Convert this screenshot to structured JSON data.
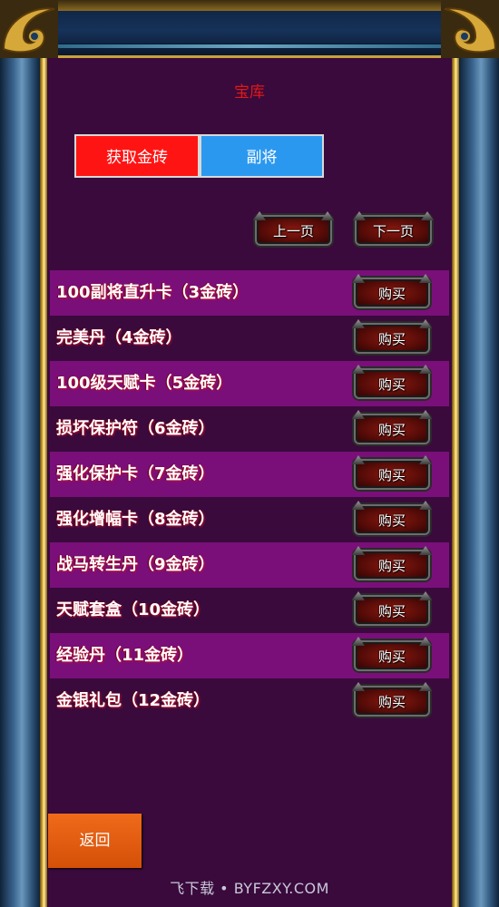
{
  "header": {
    "title": "宝库"
  },
  "tabs": [
    {
      "label": "获取金砖",
      "color": "#ff1414"
    },
    {
      "label": "副将",
      "color": "#2b98f0"
    }
  ],
  "pager": {
    "prev_label": "上一页",
    "next_label": "下一页"
  },
  "items": [
    {
      "name": "100副将直升卡（3金砖）",
      "button": "购买"
    },
    {
      "name": "完美丹（4金砖）",
      "button": "购买"
    },
    {
      "name": "100级天赋卡（5金砖）",
      "button": "购买"
    },
    {
      "name": "损坏保护符（6金砖）",
      "button": "购买"
    },
    {
      "name": "强化保护卡（7金砖）",
      "button": "购买"
    },
    {
      "name": "强化增幅卡（8金砖）",
      "button": "购买"
    },
    {
      "name": "战马转生丹（9金砖）",
      "button": "购买"
    },
    {
      "name": "天赋套盒（10金砖）",
      "button": "购买"
    },
    {
      "name": "经验丹（11金砖）",
      "button": "购买"
    },
    {
      "name": "金银礼包（12金砖）",
      "button": "购买"
    }
  ],
  "footer": {
    "back_label": "返回"
  },
  "watermark": "飞下载 • BYFZXY.COM",
  "colors": {
    "panel": "#3a0a3c",
    "row_highlight": "#7a0f7a",
    "title_red": "#e01818",
    "back_button": "#e85e10"
  }
}
